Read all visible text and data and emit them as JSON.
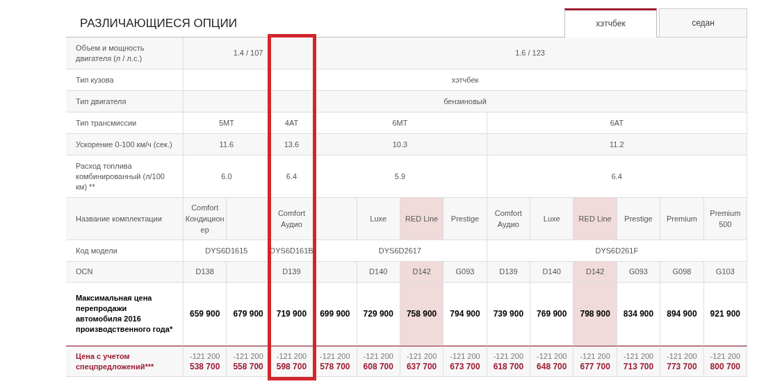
{
  "title": "РАЗЛИЧАЮЩИЕСЯ ОПЦИИ",
  "tabs": [
    {
      "label": "хэтчбек",
      "selected": true
    },
    {
      "label": "седан",
      "selected": false
    }
  ],
  "labels": {
    "engine": "Объем и мощность двигателя (л / л.с.)",
    "body": "Тип кузова",
    "engine_type": "Тип двигателя",
    "transmission": "Тип трансмиссии",
    "acceleration": "Ускорение 0-100 км/ч (сек.)",
    "fuel": "Расход топлива комбинированный (л/100 км) **",
    "trim": "Название комплектации",
    "model_code": "Код модели",
    "ocn": "OCN",
    "price": "Максимальная цена перепродажи автомобиля 2016 производственного года*",
    "discounted_price": "Цена с учетом спецпредложений***"
  },
  "body_type": "хэтчбек",
  "engine_type": "бензиновый",
  "engines": [
    {
      "volume": "1.4 / 107",
      "transmissions": [
        {
          "type": "5MT",
          "acceleration": "11.6",
          "fuel": "6.0",
          "model_code": "DYS6D1615",
          "trims": [
            {
              "name": "Comfort Кондиционер",
              "ocn": "D138",
              "price": "659 900",
              "discount": "-121 200",
              "discounted_price": "538 700",
              "highlighted": false,
              "framed": false
            },
            {
              "price": "679 900",
              "discount": "-121 200",
              "discounted_price": "558 700",
              "highlighted": false,
              "framed": false
            }
          ]
        },
        {
          "type": "4AT",
          "acceleration": "13.6",
          "fuel": "6.4",
          "model_code": "DYS6D161B",
          "trims": [
            {
              "name": "Comfort Аудио",
              "ocn": "D139",
              "price": "719 900",
              "discount": "-121 200",
              "discounted_price": "598 700",
              "highlighted": false,
              "framed": true
            }
          ]
        }
      ]
    },
    {
      "volume": "1.6 / 123",
      "transmissions": [
        {
          "type": "6MT",
          "acceleration": "10.3",
          "fuel": "5.9",
          "model_code": "DYS6D2617",
          "trims": [
            {
              "price": "699 900",
              "discount": "-121 200",
              "discounted_price": "578 700",
              "highlighted": false,
              "framed": false
            },
            {
              "name": "Luxe",
              "ocn": "D140",
              "price": "729 900",
              "discount": "-121 200",
              "discounted_price": "608 700",
              "highlighted": false,
              "framed": false
            },
            {
              "name": "RED Line",
              "ocn": "D142",
              "price": "758 900",
              "discount": "-121 200",
              "discounted_price": "637 700",
              "highlighted": true,
              "framed": false
            },
            {
              "name": "Prestige",
              "ocn": "G093",
              "price": "794 900",
              "discount": "-121 200",
              "discounted_price": "673 700",
              "highlighted": false,
              "framed": false
            }
          ]
        },
        {
          "type": "6AT",
          "acceleration": "11.2",
          "fuel": "6.4",
          "model_code": "DYS6D261F",
          "trims": [
            {
              "name": "Comfort Аудио",
              "ocn": "D139",
              "price": "739 900",
              "discount": "-121 200",
              "discounted_price": "618 700",
              "highlighted": false,
              "framed": false
            },
            {
              "name": "Luxe",
              "ocn": "D140",
              "price": "769 900",
              "discount": "-121 200",
              "discounted_price": "648 700",
              "highlighted": false,
              "framed": false
            },
            {
              "name": "RED Line",
              "ocn": "D142",
              "price": "798 900",
              "discount": "-121 200",
              "discounted_price": "677 700",
              "highlighted": true,
              "framed": false
            },
            {
              "name": "Prestige",
              "ocn": "G093",
              "price": "834 900",
              "discount": "-121 200",
              "discounted_price": "713 700",
              "highlighted": false,
              "framed": false
            },
            {
              "name": "Premium",
              "ocn": "G098",
              "price": "894 900",
              "discount": "-121 200",
              "discounted_price": "773 700",
              "highlighted": false,
              "framed": false
            },
            {
              "name": "Premium 500",
              "ocn": "G103",
              "price": "921 900",
              "discount": "-121 200",
              "discounted_price": "800 700",
              "highlighted": false,
              "framed": false
            }
          ]
        }
      ]
    }
  ]
}
